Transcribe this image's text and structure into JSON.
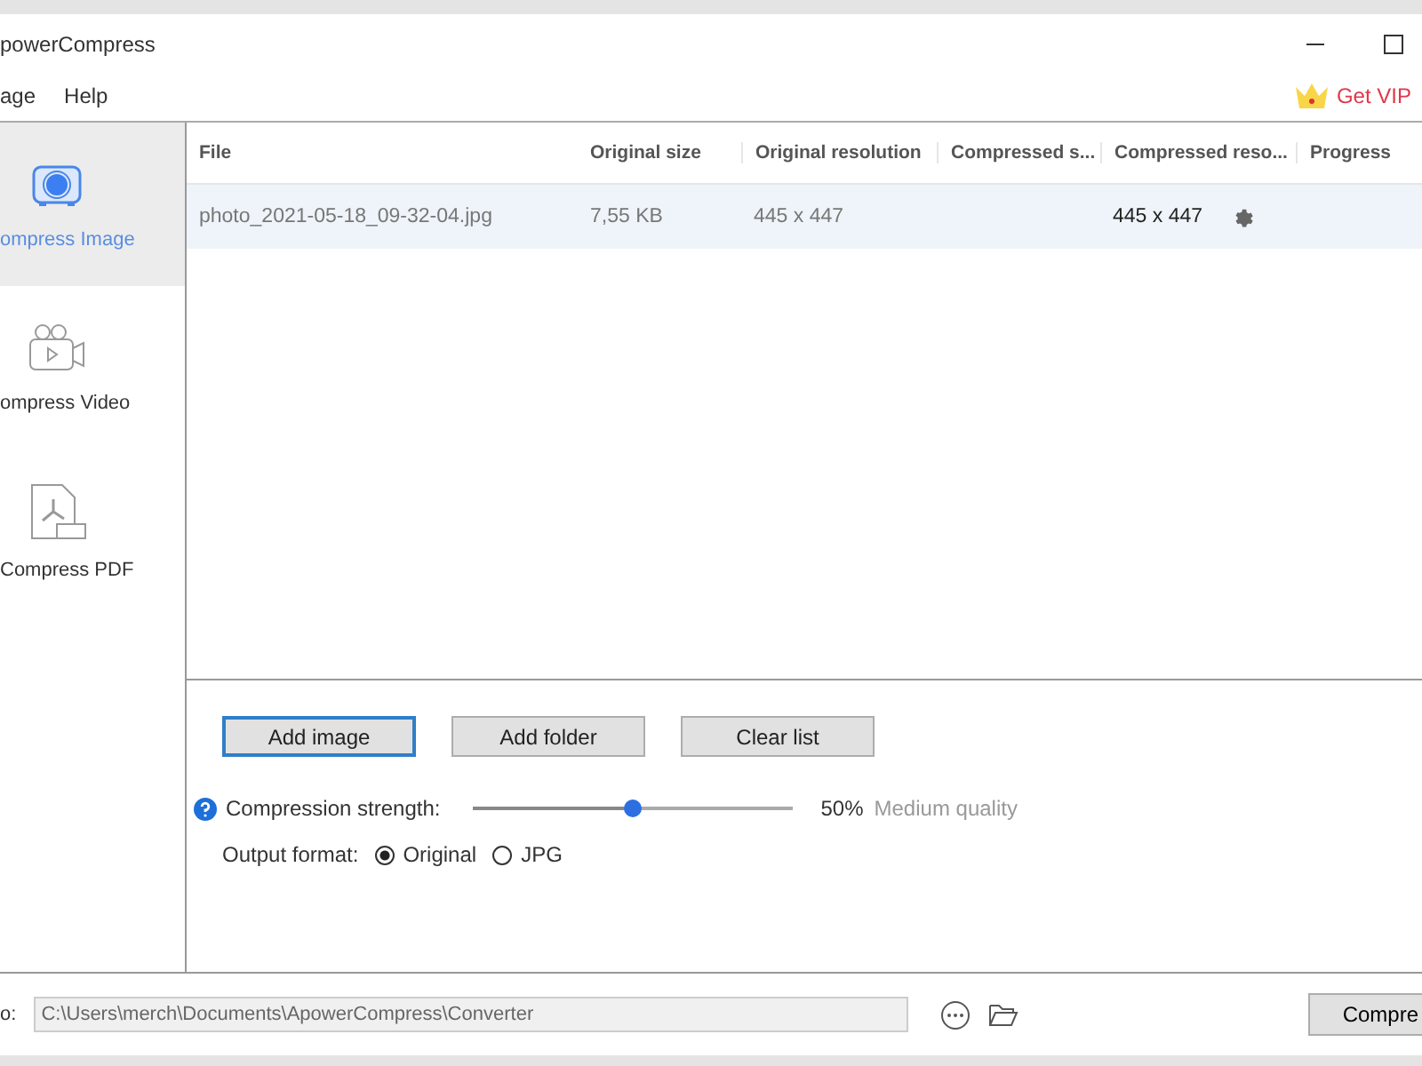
{
  "window": {
    "title": "powerCompress"
  },
  "menu": [
    "age",
    "Help"
  ],
  "vip": {
    "label": "Get VIP"
  },
  "sidebar": {
    "items": [
      {
        "label": "ompress Image",
        "kind": "image",
        "selected": true
      },
      {
        "label": "ompress Video",
        "kind": "video",
        "selected": false
      },
      {
        "label": "Compress PDF",
        "kind": "pdf",
        "selected": false
      }
    ]
  },
  "table": {
    "columns": [
      "File",
      "Original size",
      "Original resolution",
      "Compressed s...",
      "Compressed reso...",
      "Progress"
    ],
    "rows": [
      {
        "file": "photo_2021-05-18_09-32-04.jpg",
        "original_size": "7,55 KB",
        "original_resolution": "445 x 447",
        "compressed_size": "",
        "compressed_resolution": "445 x 447",
        "selected": true
      }
    ]
  },
  "buttons": [
    {
      "label": "Add image",
      "selected": true
    },
    {
      "label": "Add folder",
      "selected": false
    },
    {
      "label": "Clear list",
      "selected": false
    }
  ],
  "compression": {
    "label": "Compression strength:",
    "level": 0.5,
    "percent": "50%",
    "quality": "Medium quality"
  },
  "output_format": {
    "label": "Output format:",
    "options": [
      {
        "label": "Original",
        "selected": true
      },
      {
        "label": "JPG",
        "selected": false
      }
    ]
  },
  "footer": {
    "label": "o:",
    "path": "C:\\Users\\merch\\Documents\\ApowerCompress\\Converter",
    "button": "Compre"
  }
}
